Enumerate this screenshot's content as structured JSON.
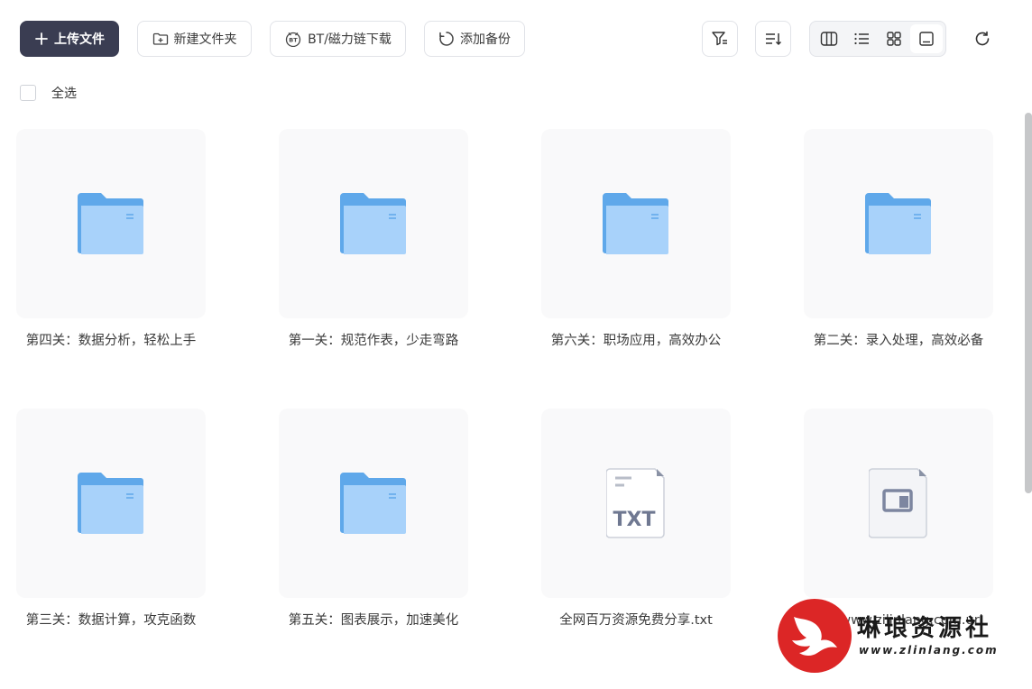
{
  "toolbar": {
    "upload_label": "上传文件",
    "new_folder_label": "新建文件夹",
    "bt_label": "BT/磁力链下载",
    "backup_label": "添加备份",
    "filter_icon": "filter-icon",
    "sort_icon": "sort-icon",
    "view_modes": [
      "column-view-icon",
      "list-view-icon",
      "grid-view-icon",
      "preview-view-icon"
    ],
    "active_view": "preview-view-icon",
    "refresh_icon": "refresh-icon"
  },
  "select_all_label": "全选",
  "files": [
    {
      "name": "第四关：数据分析，轻松上手",
      "type": "folder"
    },
    {
      "name": "第一关：规范作表，少走弯路",
      "type": "folder"
    },
    {
      "name": "第六关：职场应用，高效办公",
      "type": "folder"
    },
    {
      "name": "第二关：录入处理，高效必备",
      "type": "folder"
    },
    {
      "name": "第三关：数据计算，攻克函数",
      "type": "folder"
    },
    {
      "name": "第五关：图表展示，加速美化",
      "type": "folder"
    },
    {
      "name": "全网百万资源免费分享.txt",
      "type": "txt",
      "badge": "TXT"
    },
    {
      "name": "源社www.zilinlang.com.url",
      "type": "url"
    }
  ],
  "colors": {
    "primary": "#3a3d52",
    "folder_back": "#5fa8ea",
    "folder_front": "#a8d2fa",
    "watermark_red": "#dc2626"
  },
  "watermark": {
    "title": "琳琅资源社",
    "subtitle": "www.zlinlang.com"
  }
}
